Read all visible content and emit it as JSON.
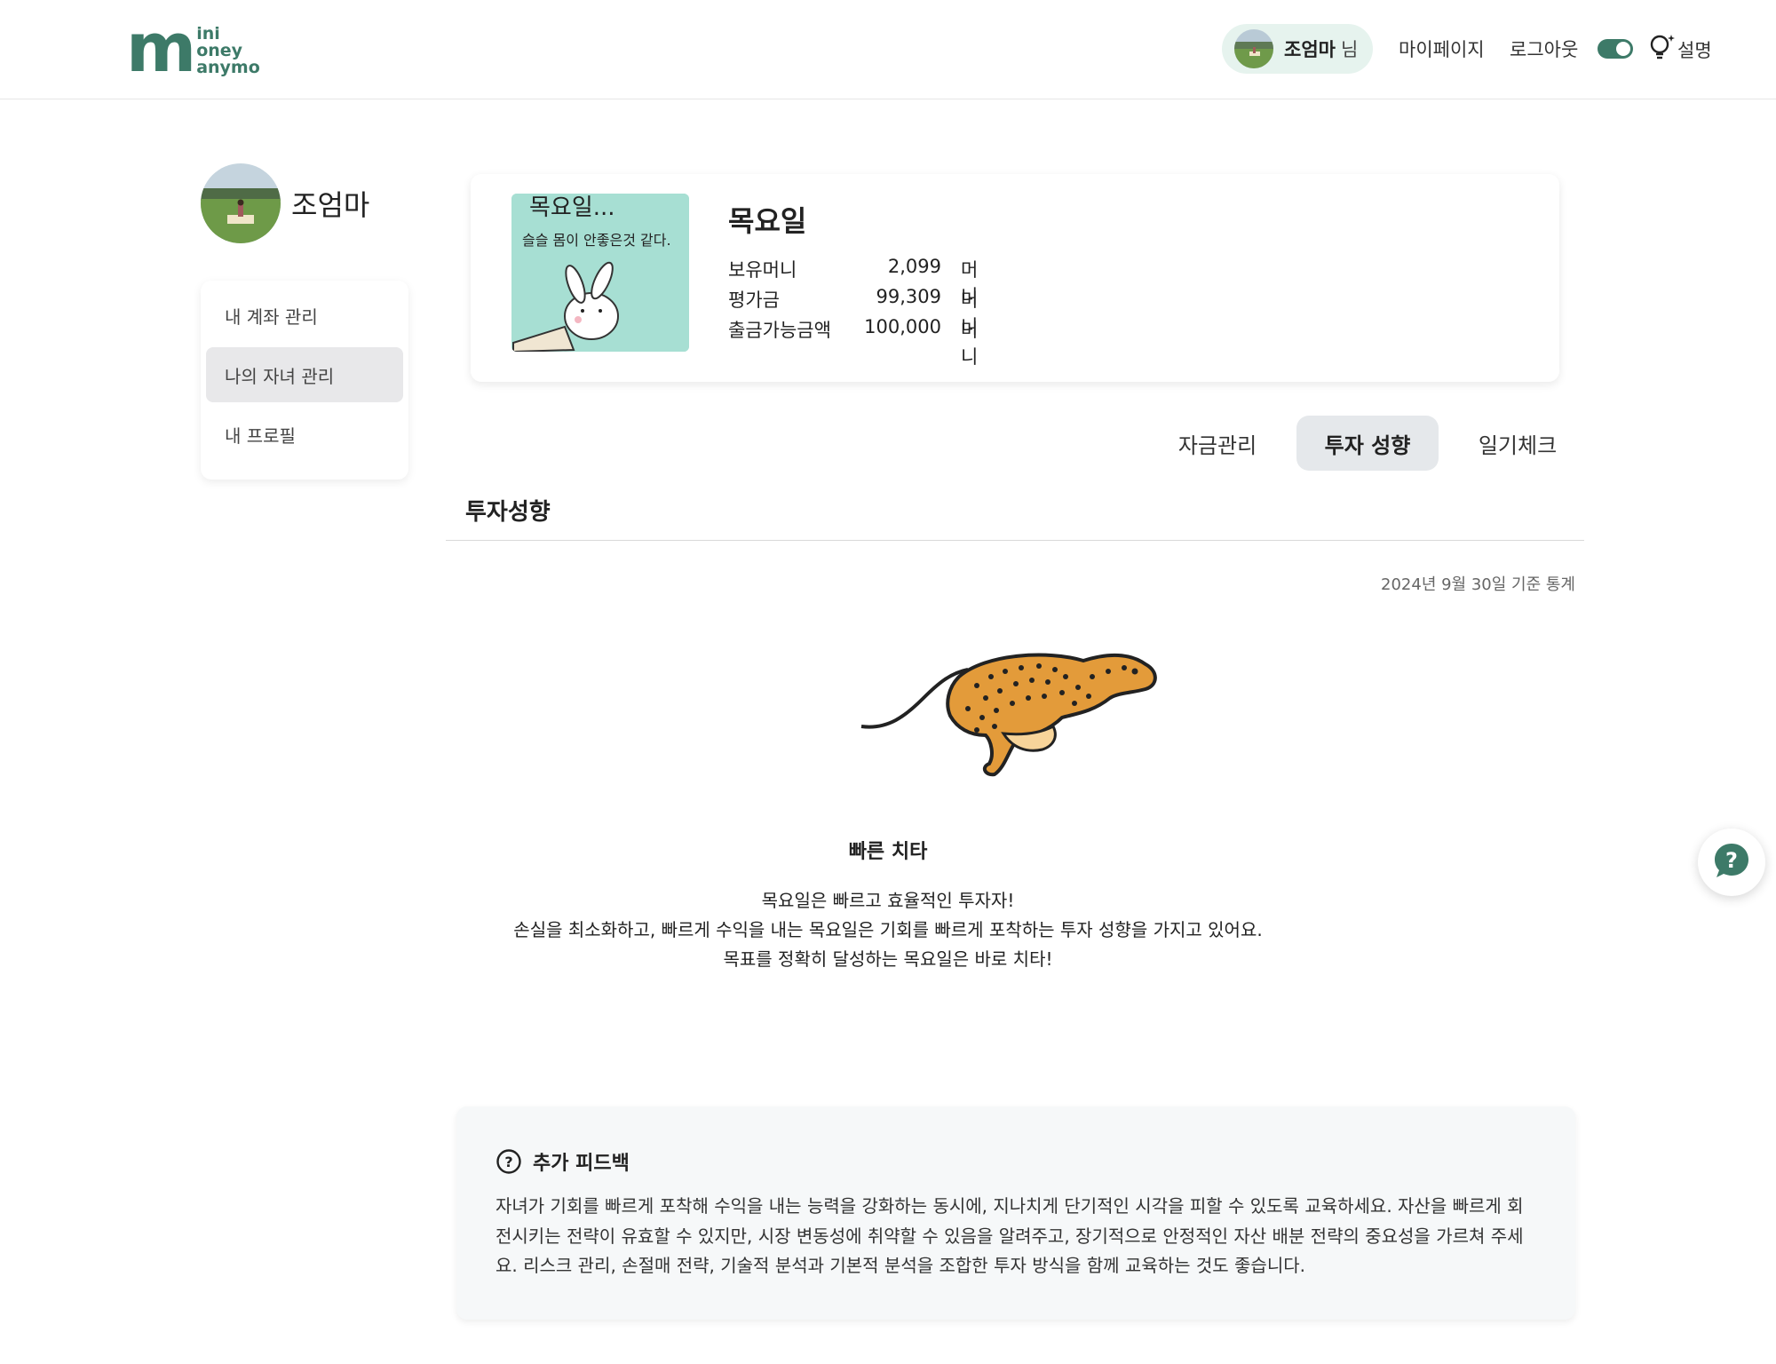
{
  "header": {
    "logo": {
      "big_letter": "m",
      "line1": "ini",
      "line2": "oney",
      "line3": "anymo"
    },
    "user_name": "조엄마",
    "user_suffix": "님",
    "nav_mypage": "마이페이지",
    "nav_logout": "로그아웃",
    "help_label": "설명",
    "toggle_on": true,
    "accent_color": "#3d7a68"
  },
  "sidebar": {
    "profile_name": "조엄마",
    "items": [
      {
        "label": "내 계좌 관리",
        "active": false
      },
      {
        "label": "나의 자녀 관리",
        "active": true
      },
      {
        "label": "내 프로필",
        "active": false
      }
    ]
  },
  "child": {
    "name": "목요일",
    "image_text_line1": "목요일...",
    "image_text_line2": "슬슬 몸이 안좋은것 같다.",
    "stats": [
      {
        "label": "보유머니",
        "value": "2,099",
        "unit": "머니"
      },
      {
        "label": "평가금",
        "value": "99,309",
        "unit": "머니"
      },
      {
        "label": "출금가능금액",
        "value": "100,000",
        "unit": "머니"
      }
    ]
  },
  "tabs": [
    {
      "label": "자금관리",
      "active": false
    },
    {
      "label": "투자 성향",
      "active": true
    },
    {
      "label": "일기체크",
      "active": false
    }
  ],
  "section": {
    "title": "투자성향",
    "date": "2024년 9월 30일 기준 통계",
    "type_name": "빠른 치타",
    "desc_lines": [
      "목요일은 빠르고 효율적인 투자자!",
      "손실을 최소화하고, 빠르게 수익을 내는 목요일은 기회를 빠르게 포착하는 투자 성향을 가지고 있어요.",
      "목표를 정확히 달성하는 목요일은 바로 치타!"
    ]
  },
  "feedback": {
    "title": "추가 피드백",
    "body": "자녀가 기회를 빠르게 포착해 수익을 내는 능력을 강화하는 동시에, 지나치게 단기적인 시각을 피할 수 있도록 교육하세요. 자산을 빠르게 회전시키는 전략이 유효할 수 있지만, 시장 변동성에 취약할 수 있음을 알려주고, 장기적으로 안정적인 자산 배분 전략의 중요성을 가르쳐 주세요. 리스크 관리, 손절매 전략, 기술적 분석과 기본적 분석을 조합한 투자 방식을 함께 교육하는 것도 좋습니다."
  },
  "icons": {
    "help_header": "lightbulb-icon",
    "float_help": "question-chat-icon",
    "feedback": "question-circle-icon"
  }
}
